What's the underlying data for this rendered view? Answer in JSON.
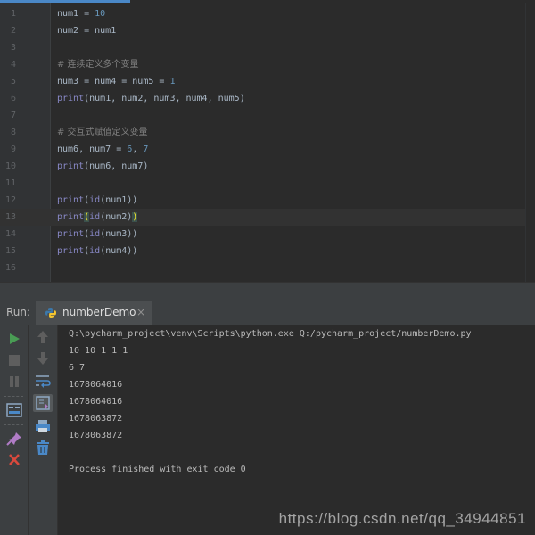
{
  "editor": {
    "lines": [
      {
        "n": "1",
        "tokens": [
          [
            "t",
            "num1 = "
          ],
          [
            "n",
            "10"
          ]
        ]
      },
      {
        "n": "2",
        "tokens": [
          [
            "t",
            "num2 = num1"
          ]
        ]
      },
      {
        "n": "3",
        "tokens": []
      },
      {
        "n": "4",
        "tokens": [
          [
            "c",
            "# 连续定义多个变量"
          ]
        ]
      },
      {
        "n": "5",
        "tokens": [
          [
            "t",
            "num3 = num4 = num5 = "
          ],
          [
            "n",
            "1"
          ]
        ]
      },
      {
        "n": "6",
        "tokens": [
          [
            "b",
            "print"
          ],
          [
            "t",
            "(num1, num2, num3, num4, num5)"
          ]
        ]
      },
      {
        "n": "7",
        "tokens": []
      },
      {
        "n": "8",
        "tokens": [
          [
            "c",
            "# 交互式赋值定义变量"
          ]
        ]
      },
      {
        "n": "9",
        "tokens": [
          [
            "t",
            "num6, num7 = "
          ],
          [
            "n",
            "6"
          ],
          [
            "t",
            ", "
          ],
          [
            "n",
            "7"
          ]
        ]
      },
      {
        "n": "10",
        "tokens": [
          [
            "b",
            "print"
          ],
          [
            "t",
            "(num6, num7)"
          ]
        ]
      },
      {
        "n": "11",
        "tokens": []
      },
      {
        "n": "12",
        "tokens": [
          [
            "b",
            "print"
          ],
          [
            "t",
            "("
          ],
          [
            "b",
            "id"
          ],
          [
            "t",
            "(num1))"
          ]
        ]
      },
      {
        "n": "13",
        "tokens": [
          [
            "b",
            "print"
          ],
          [
            "h",
            "("
          ],
          [
            "b",
            "id"
          ],
          [
            "t",
            "(num2)"
          ],
          [
            "h",
            ")"
          ]
        ]
      },
      {
        "n": "14",
        "tokens": [
          [
            "b",
            "print"
          ],
          [
            "t",
            "("
          ],
          [
            "b",
            "id"
          ],
          [
            "t",
            "(num3))"
          ]
        ]
      },
      {
        "n": "15",
        "tokens": [
          [
            "b",
            "print"
          ],
          [
            "t",
            "("
          ],
          [
            "b",
            "id"
          ],
          [
            "t",
            "(num4))"
          ]
        ]
      },
      {
        "n": "16",
        "tokens": []
      }
    ]
  },
  "run_panel": {
    "label": "Run:",
    "tab_title": "numberDemo",
    "close_glyph": "×",
    "output_lines": [
      "Q:\\pycharm_project\\venv\\Scripts\\python.exe Q:/pycharm_project/numberDemo.py",
      "10 10 1 1 1",
      "6 7",
      "1678064016",
      "1678064016",
      "1678063872",
      "1678063872",
      "",
      "Process finished with exit code 0"
    ],
    "toolbar_icons": [
      "run-icon",
      "stop-icon",
      "pause-icon",
      "layout-icon",
      "pin-icon",
      "close-icon",
      "up-arrow-icon",
      "down-arrow-icon",
      "soft-wrap-icon",
      "scroll-to-end-icon",
      "print-icon",
      "trash-icon"
    ]
  },
  "watermark": "https://blog.csdn.net/qq_34944851",
  "colors": {
    "background": "#2b2b2b",
    "panel": "#3c3f41",
    "number": "#6897bb",
    "builtin": "#8888c6",
    "comment": "#808080",
    "text": "#a9b7c6"
  }
}
